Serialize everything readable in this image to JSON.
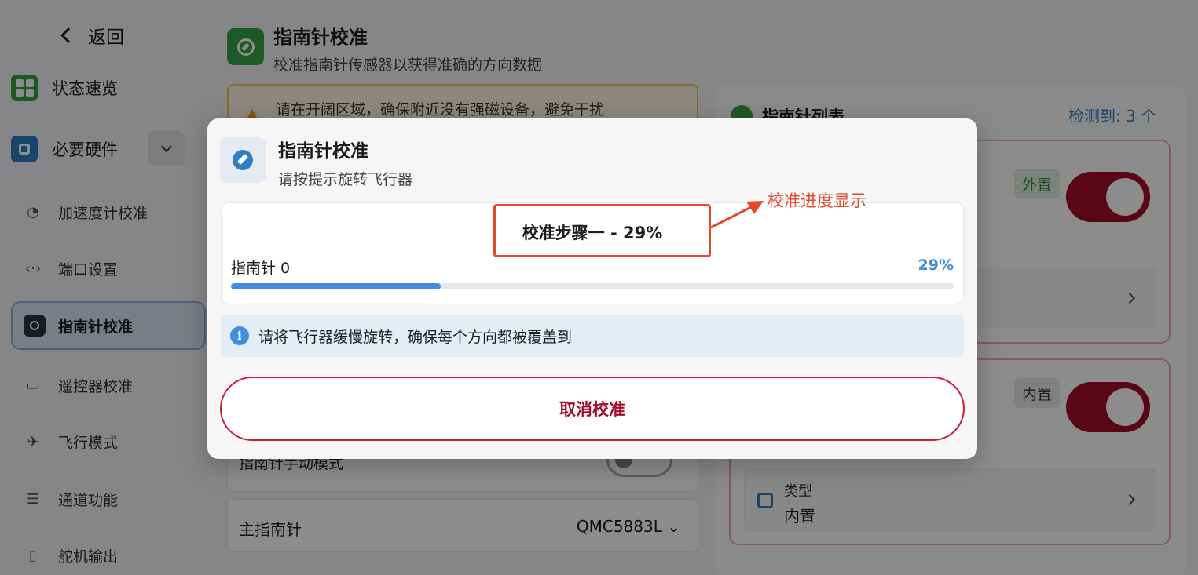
{
  "sidebar": {
    "back_label": "返回",
    "overview_label": "状态速览",
    "hardware_label": "必要硬件",
    "items": [
      {
        "label": "加速度计校准"
      },
      {
        "label": "端口设置"
      },
      {
        "label": "指南针校准"
      },
      {
        "label": "遥控器校准"
      },
      {
        "label": "飞行模式"
      },
      {
        "label": "通道功能"
      },
      {
        "label": "舵机输出"
      }
    ]
  },
  "page": {
    "title": "指南针校准",
    "subtitle": "校准指南针传感器以获得准确的方向数据",
    "warning": "请在开阔区域，确保附近没有强磁设备，避免干扰",
    "manual_mode_label": "指南针手动模式",
    "primary_compass_label": "主指南针",
    "primary_compass_value": "QMC5883L"
  },
  "compass_list": {
    "title": "指南针列表",
    "count_text": "检测到: 3 个",
    "cards": [
      {
        "tag": "外置",
        "enabled": true
      },
      {
        "tag": "内置",
        "enabled": true,
        "type_key": "类型",
        "type_value": "内置"
      }
    ]
  },
  "modal": {
    "title": "指南针校准",
    "subtitle": "请按提示旋转飞行器",
    "step_text": "校准步骤一 - 29%",
    "compass_label": "指南针 0",
    "progress_text": "29%",
    "progress": 0.29,
    "info_text": "请将飞行器缓慢旋转，确保每个方向都被覆盖到",
    "cancel_label": "取消校准"
  },
  "annotation": {
    "text": "校准进度显示",
    "color": "#e34a2b"
  },
  "colors": {
    "accent_blue": "#3f8fdb",
    "danger_red": "#a30d2b",
    "success_green": "#3aa24a"
  }
}
